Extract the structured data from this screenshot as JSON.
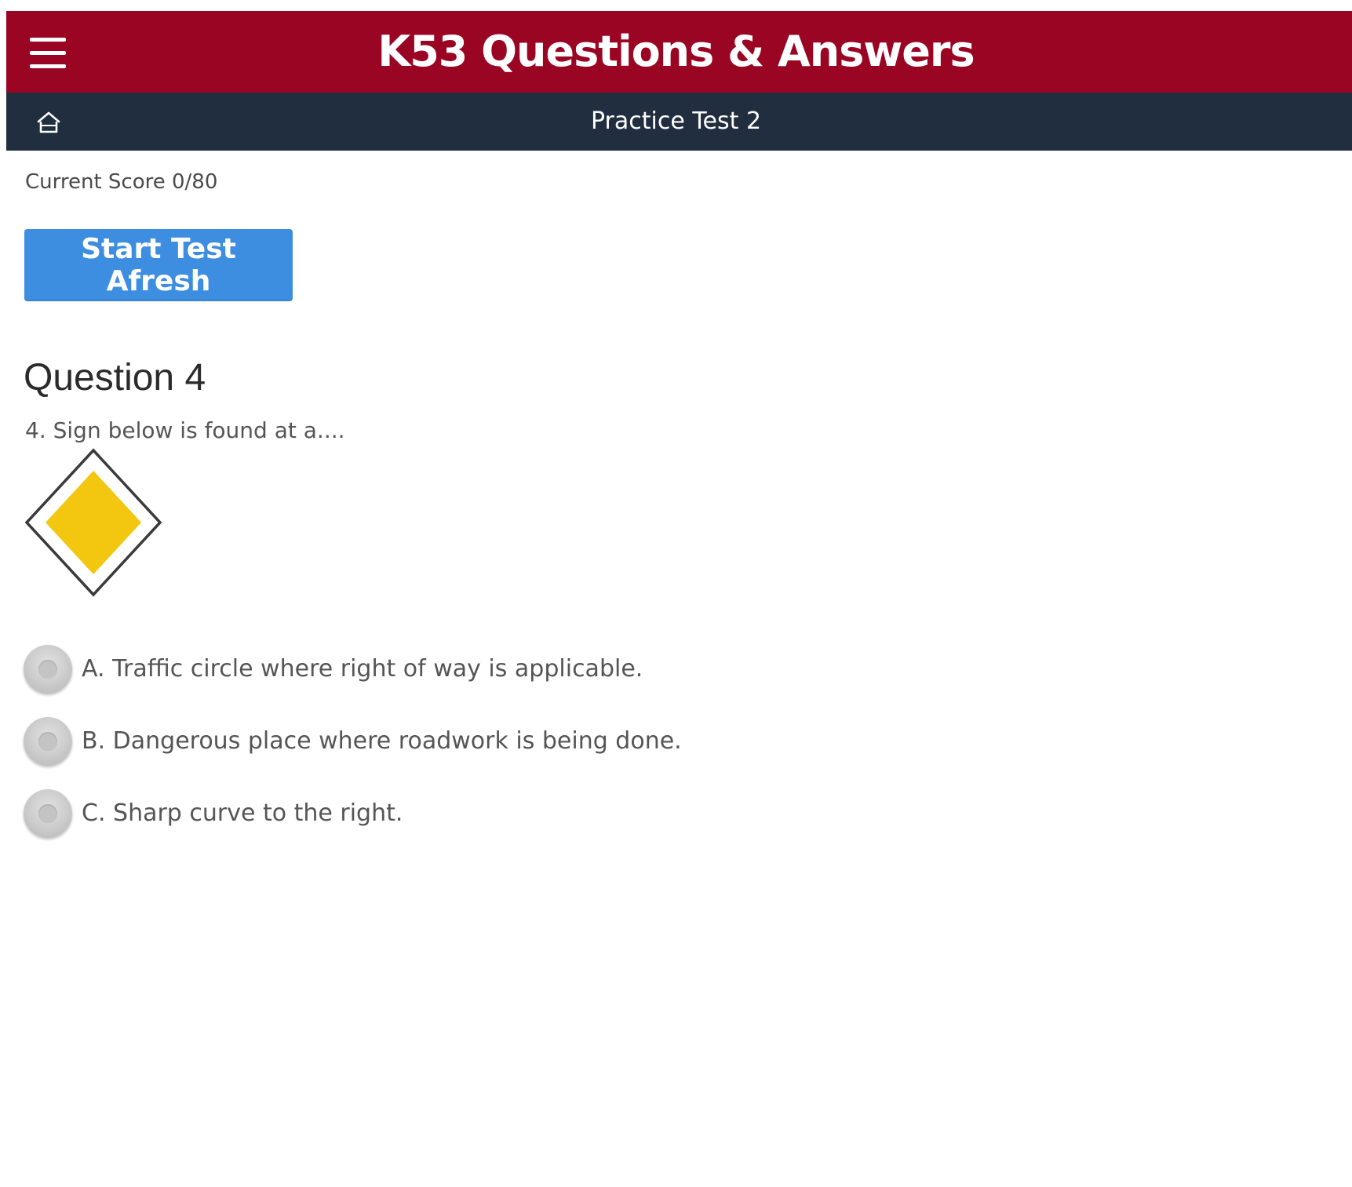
{
  "header": {
    "title": "K53 Questions & Answers",
    "menu_icon": "hamburger-menu-icon",
    "brand_color": "#9a0524"
  },
  "subheader": {
    "title": "Practice Test 2",
    "home_icon": "home-icon",
    "background_color": "#212e3f"
  },
  "score": {
    "text": "Current Score 0/80"
  },
  "restart_button": {
    "label": "Start Test Afresh",
    "color": "#3d8ee0"
  },
  "question": {
    "heading": "Question 4",
    "text": "4. Sign below is found at a....",
    "sign_icon": "priority-road-sign-icon",
    "options": [
      {
        "label": "A. Traffic circle where right of way is applicable."
      },
      {
        "label": "B. Dangerous place where roadwork is being done."
      },
      {
        "label": "C. Sharp curve to the right."
      }
    ]
  }
}
